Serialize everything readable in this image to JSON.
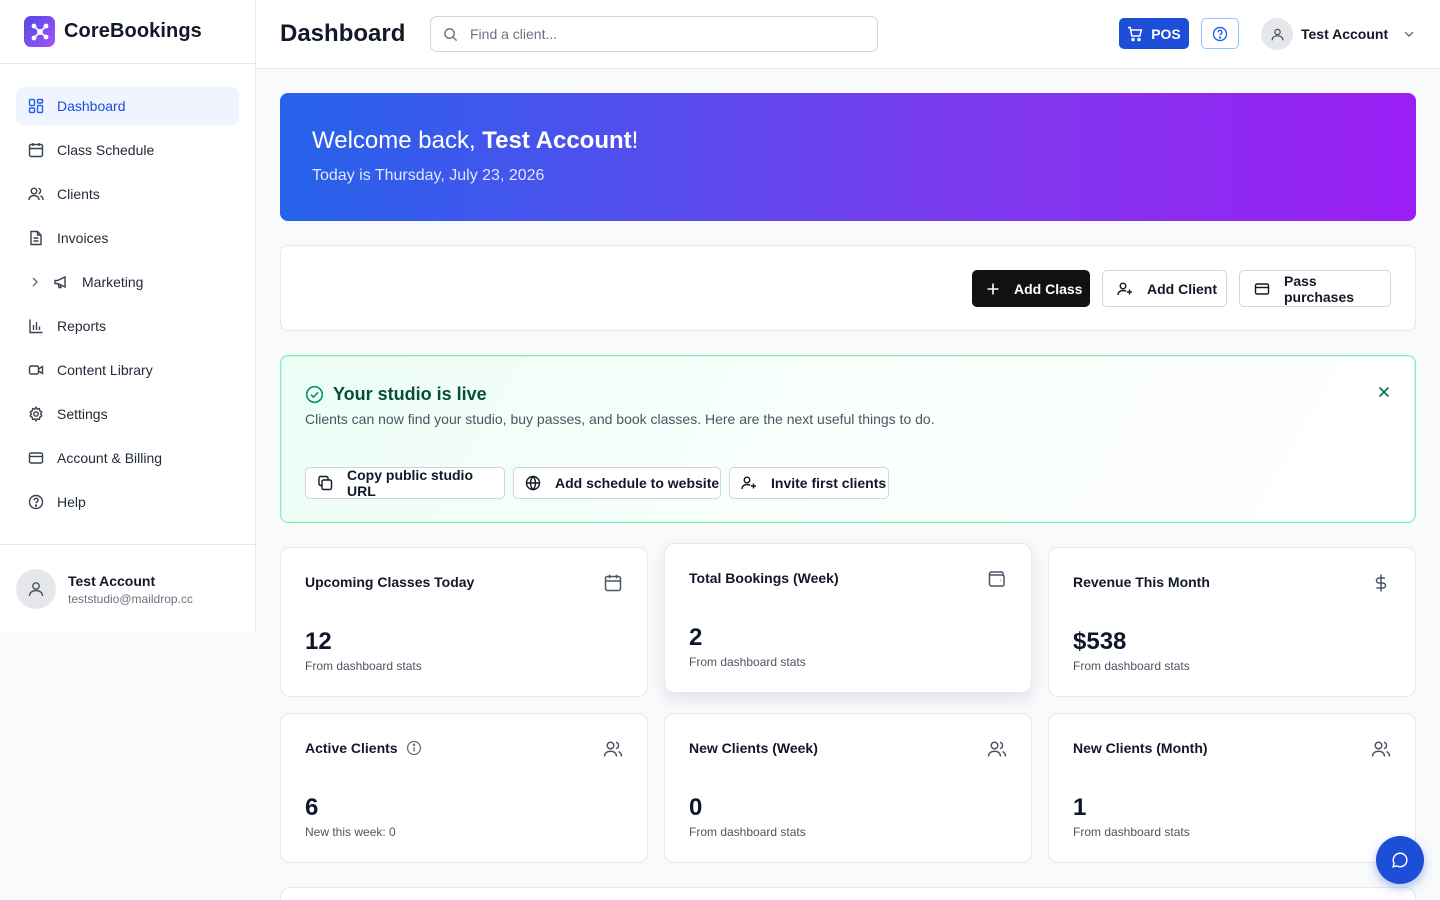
{
  "brand": {
    "name": "CoreBookings"
  },
  "sidebar": {
    "items": [
      {
        "label": "Dashboard",
        "icon": "dashboard-icon",
        "active": true
      },
      {
        "label": "Class Schedule",
        "icon": "calendar-icon"
      },
      {
        "label": "Clients",
        "icon": "users-icon"
      },
      {
        "label": "Invoices",
        "icon": "document-icon"
      },
      {
        "label": "Marketing",
        "icon": "megaphone-icon",
        "expandable": true
      },
      {
        "label": "Reports",
        "icon": "bar-chart-icon"
      },
      {
        "label": "Content Library",
        "icon": "video-icon"
      },
      {
        "label": "Settings",
        "icon": "gear-icon"
      },
      {
        "label": "Account & Billing",
        "icon": "credit-card-icon"
      },
      {
        "label": "Help",
        "icon": "help-circle-icon"
      }
    ],
    "user": {
      "name": "Test Account",
      "email": "teststudio@maildrop.cc"
    }
  },
  "header": {
    "title": "Dashboard",
    "search_placeholder": "Find a client...",
    "pos_label": "POS",
    "account_name": "Test Account"
  },
  "banner": {
    "welcome_prefix": "Welcome back, ",
    "user_name": "Test Account",
    "welcome_suffix": "!",
    "date_text": "Today is Thursday, July 23, 2026"
  },
  "quick_actions": {
    "add_class": "Add Class",
    "add_client": "Add Client",
    "pass_purchases": "Pass purchases"
  },
  "live_notice": {
    "title": "Your studio is live",
    "description": "Clients can now find your studio, buy passes, and book classes. Here are the next useful things to do.",
    "copy_url": "Copy public studio URL",
    "add_schedule": "Add schedule to website",
    "invite_clients": "Invite first clients"
  },
  "stats": [
    {
      "label": "Upcoming Classes Today",
      "value": "12",
      "sub": "From dashboard stats",
      "icon": "calendar-icon"
    },
    {
      "label": "Total Bookings (Week)",
      "value": "2",
      "sub": "From dashboard stats",
      "icon": "wallet-icon"
    },
    {
      "label": "Revenue This Month",
      "value": "$538",
      "sub": "From dashboard stats",
      "icon": "dollar-icon"
    },
    {
      "label": "Active Clients",
      "value": "6",
      "sub": "New this week: 0",
      "icon": "users-icon"
    },
    {
      "label": "New Clients (Week)",
      "value": "0",
      "sub": "From dashboard stats",
      "icon": "users-icon"
    },
    {
      "label": "New Clients (Month)",
      "value": "1",
      "sub": "From dashboard stats",
      "icon": "users-icon"
    }
  ],
  "colors": {
    "accent": "#1d4ed8",
    "success": "#059669",
    "gradient_start": "#2563eb",
    "gradient_end": "#9b1ef5"
  }
}
